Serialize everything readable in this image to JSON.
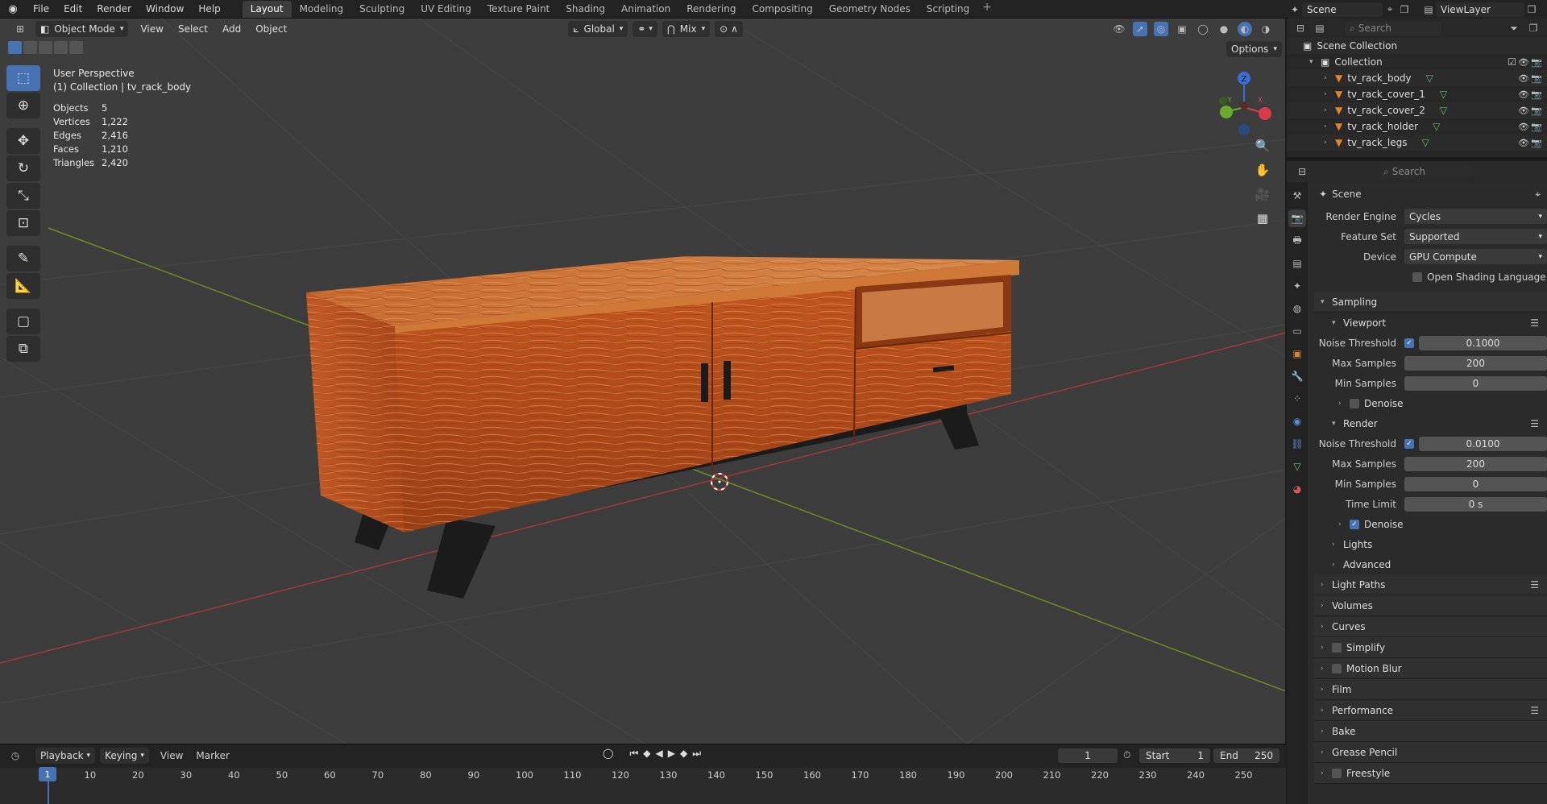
{
  "menus": [
    "File",
    "Edit",
    "Render",
    "Window",
    "Help"
  ],
  "workspaces": [
    "Layout",
    "Modeling",
    "Sculpting",
    "UV Editing",
    "Texture Paint",
    "Shading",
    "Animation",
    "Rendering",
    "Compositing",
    "Geometry Nodes",
    "Scripting"
  ],
  "scene_name": "Scene",
  "view_layer": "ViewLayer",
  "viewport": {
    "mode": "Object Mode",
    "menus": [
      "View",
      "Select",
      "Add",
      "Object"
    ],
    "transform": "Global",
    "snap": "Mix",
    "options_label": "Options",
    "perspective": "User Perspective",
    "context": "(1) Collection | tv_rack_body",
    "stats": [
      {
        "label": "Objects",
        "value": "5"
      },
      {
        "label": "Vertices",
        "value": "1,222"
      },
      {
        "label": "Edges",
        "value": "2,416"
      },
      {
        "label": "Faces",
        "value": "1,210"
      },
      {
        "label": "Triangles",
        "value": "2,420"
      }
    ],
    "gizmo": {
      "z": "Z",
      "y": "Y",
      "x": "X"
    }
  },
  "outliner": {
    "search_placeholder": "Search",
    "root": "Scene Collection",
    "collection": "Collection",
    "objects": [
      "tv_rack_body",
      "tv_rack_cover_1",
      "tv_rack_cover_2",
      "tv_rack_holder",
      "tv_rack_legs"
    ]
  },
  "properties": {
    "search_placeholder": "Search",
    "context": "Scene",
    "render_engine": {
      "label": "Render Engine",
      "value": "Cycles"
    },
    "feature_set": {
      "label": "Feature Set",
      "value": "Supported"
    },
    "device": {
      "label": "Device",
      "value": "GPU Compute"
    },
    "osl": "Open Shading Language",
    "sampling": "Sampling",
    "viewport_sub": "Viewport",
    "render_sub": "Render",
    "noise_threshold": "Noise Threshold",
    "max_samples": "Max Samples",
    "min_samples": "Min Samples",
    "time_limit": "Time Limit",
    "vp_noise": "0.1000",
    "vp_max": "200",
    "vp_min": "0",
    "r_noise": "0.0100",
    "r_max": "200",
    "r_min": "0",
    "r_time": "0 s",
    "denoise": "Denoise",
    "lights": "Lights",
    "advanced": "Advanced",
    "sections": [
      "Light Paths",
      "Volumes",
      "Curves",
      "Simplify",
      "Motion Blur",
      "Film",
      "Performance",
      "Bake",
      "Grease Pencil",
      "Freestyle"
    ]
  },
  "timeline": {
    "menus": [
      "Playback",
      "Keying",
      "View",
      "Marker"
    ],
    "current_frame": "1",
    "start_label": "Start",
    "start": "1",
    "end_label": "End",
    "end": "250",
    "ticks": [
      "10",
      "20",
      "30",
      "40",
      "50",
      "60",
      "70",
      "80",
      "90",
      "100",
      "110",
      "120",
      "130",
      "140",
      "150",
      "160",
      "170",
      "180",
      "190",
      "200",
      "210",
      "220",
      "230",
      "240",
      "250"
    ]
  },
  "colors": {
    "accent": "#4772b3",
    "wood": "#b5501f",
    "grid_x": "#a33a3a",
    "grid_y": "#6b8e23"
  }
}
